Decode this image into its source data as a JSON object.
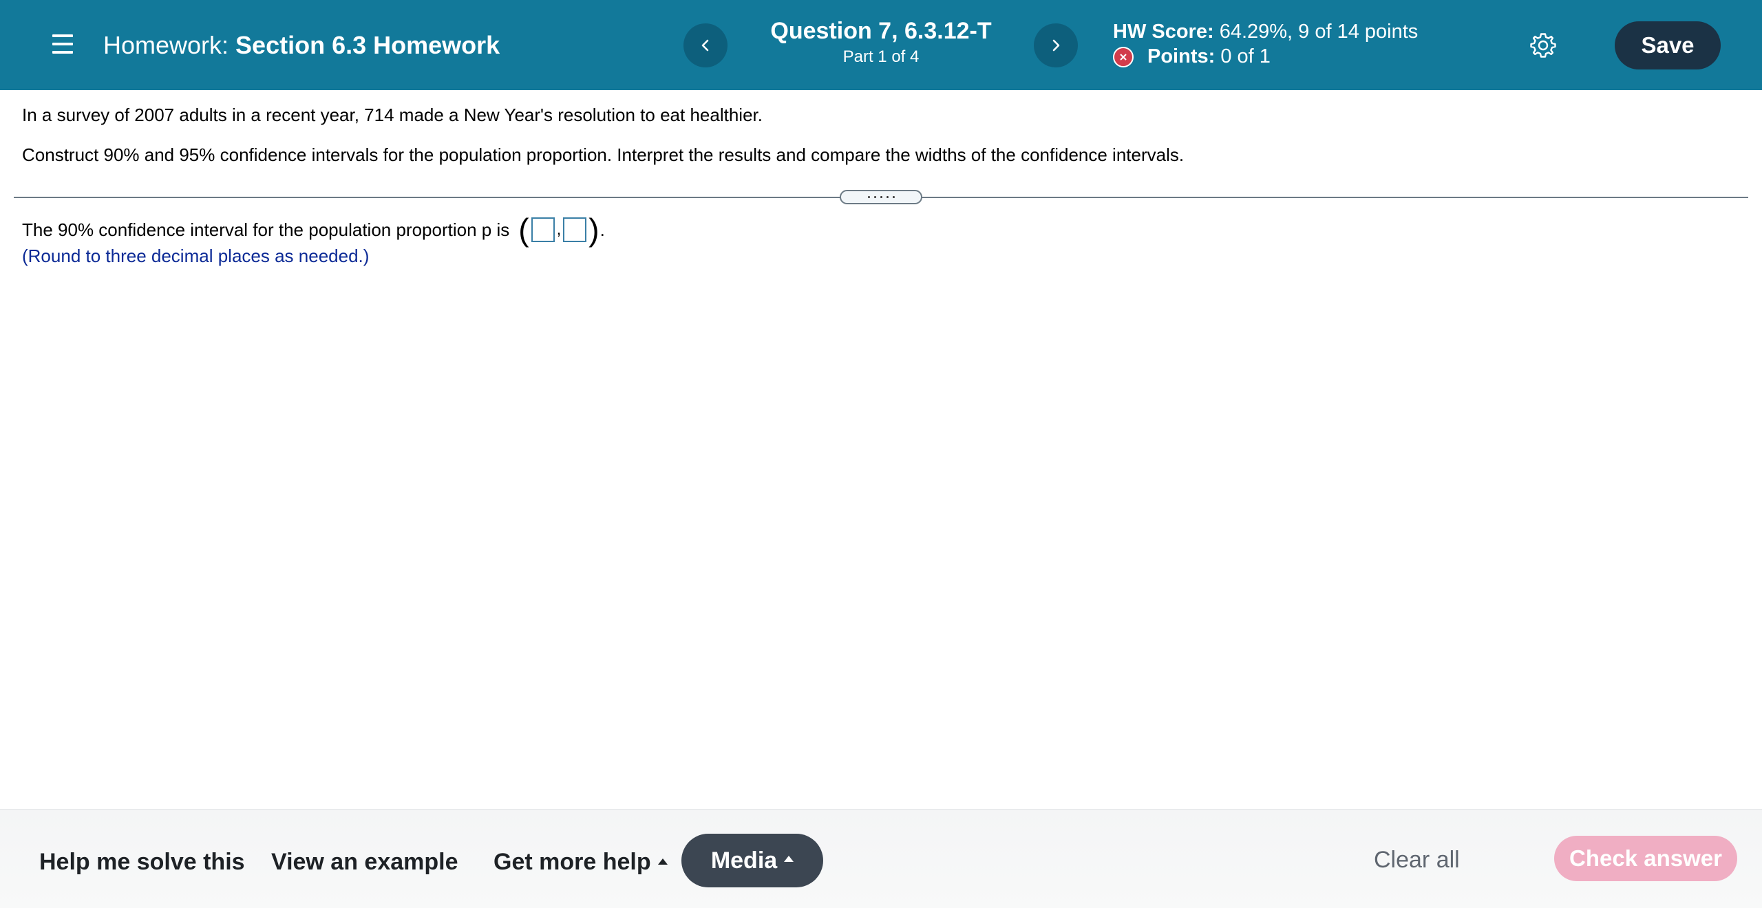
{
  "header": {
    "homework_prefix": "Homework:",
    "homework_name": "Section 6.3 Homework",
    "question_title": "Question 7, 6.3.12-T",
    "question_part": "Part 1 of 4",
    "hw_score_label": "HW Score:",
    "hw_score_value": "64.29%, 9 of 14 points",
    "points_label": "Points:",
    "points_value": "0 of 1",
    "save_label": "Save",
    "icons": {
      "menu": "menu-icon",
      "prev": "chevron-left-icon",
      "next": "chevron-right-icon",
      "status": "x-circle-icon",
      "settings": "gear-icon"
    }
  },
  "question": {
    "text_1": "In a survey of 2007 adults in a recent year, 714 made a New Year's resolution to eat healthier.",
    "text_2": "Construct 90% and 95% confidence intervals for the population proportion. Interpret the results and compare the widths of the confidence intervals.",
    "answer_prompt": "The 90% confidence interval for the population proportion p is",
    "answer_open": "(",
    "answer_separator": ",",
    "answer_close": ")",
    "answer_end": ".",
    "lower_bound_value": "",
    "upper_bound_value": "",
    "hint": "(Round to three decimal places as needed.)"
  },
  "footer": {
    "help_solve": "Help me solve this",
    "view_example": "View an example",
    "more_help": "Get more help",
    "media": "Media",
    "clear_all": "Clear all",
    "check_answer": "Check answer"
  },
  "colors": {
    "header_bg": "#12799a",
    "nav_button_bg": "#0d5f7c",
    "save_bg": "#1b3245",
    "error_red": "#d23c4b",
    "hint_blue": "#0c2a96",
    "media_bg": "#3c4652",
    "check_answer_bg": "#f0aec3"
  }
}
